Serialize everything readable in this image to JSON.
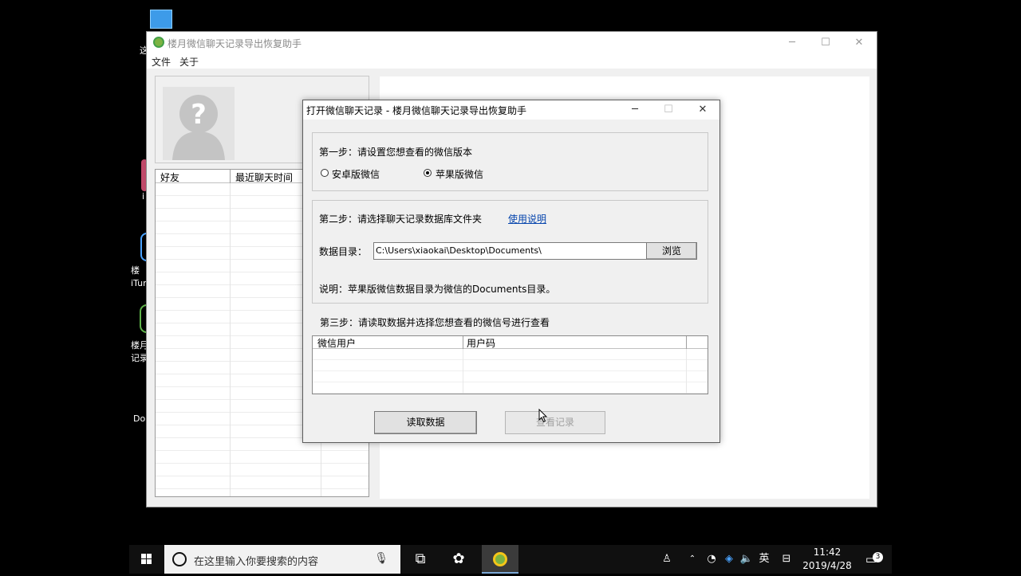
{
  "desktop": {
    "icons": [
      {
        "label": "这",
        "icon": "pc-icon"
      },
      {
        "label": "i",
        "icon": "app-icon"
      },
      {
        "label": "楼\niTun",
        "icon": "itunes-icon"
      },
      {
        "label": "楼月\n记录",
        "icon": "wechat-recovery-icon"
      },
      {
        "label": "Do",
        "icon": "document-icon"
      }
    ]
  },
  "main_window": {
    "title": "楼月微信聊天记录导出恢复助手",
    "menu": [
      "文件",
      "关于"
    ],
    "friends_table": {
      "columns": [
        "好友",
        "最近聊天时间"
      ]
    },
    "controls": {
      "minimize": "─",
      "maximize": "☐",
      "close": "✕"
    }
  },
  "dialog": {
    "title": "打开微信聊天记录 - 楼月微信聊天记录导出恢复助手",
    "controls": {
      "minimize": "─",
      "maximize": "☐",
      "close": "✕"
    },
    "step1": {
      "label": "第一步：请设置您想查看的微信版本",
      "options": [
        {
          "label": "安卓版微信",
          "checked": false
        },
        {
          "label": "苹果版微信",
          "checked": true
        }
      ]
    },
    "step2": {
      "label": "第二步：请选择聊天记录数据库文件夹",
      "help_link": "使用说明",
      "dir_label": "数据目录：",
      "dir_value": "C:\\Users\\xiaokai\\Desktop\\Documents\\",
      "browse_button": "浏览",
      "note": "说明：苹果版微信数据目录为微信的Documents目录。"
    },
    "step3": {
      "label": "第三步：请读取数据并选择您想查看的微信号进行查看",
      "columns": [
        "微信用户",
        "用户码"
      ]
    },
    "buttons": {
      "read": "读取数据",
      "view": "查看记录"
    }
  },
  "taskbar": {
    "search_placeholder": "在这里输入你要搜索的内容",
    "input_method": "英",
    "time": "11:42",
    "date": "2019/4/28",
    "notification_count": "3"
  }
}
